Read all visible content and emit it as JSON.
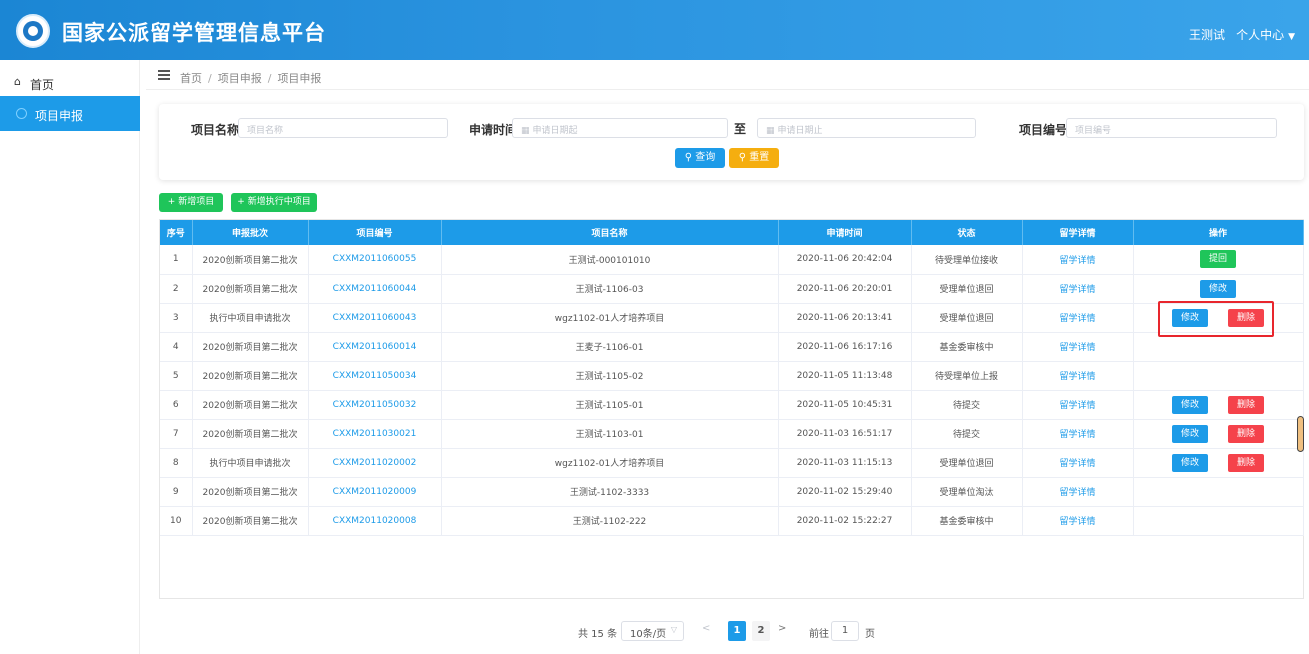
{
  "header": {
    "title": "国家公派留学管理信息平台",
    "user": "王测试",
    "user_menu": "个人中心"
  },
  "sidebar": {
    "items": [
      {
        "label": "首页"
      },
      {
        "label": "项目申报"
      }
    ]
  },
  "breadcrumb": [
    "首页",
    "项目申报",
    "项目申报"
  ],
  "search": {
    "project_name_label": "项目名称:",
    "project_name_placeholder": "项目名称",
    "apply_time_label": "申请时间:",
    "start_date_placeholder": "申请日期起",
    "to_label": "至",
    "end_date_placeholder": "申请日期止",
    "project_code_label": "项目编号:",
    "project_code_placeholder": "项目编号",
    "query_label": "查询",
    "reset_label": "重置"
  },
  "actions": {
    "add_project": "+ 新增项目",
    "add_exec_project": "+ 新增执行中项目"
  },
  "table": {
    "columns": [
      "序号",
      "申报批次",
      "项目编号",
      "项目名称",
      "申请时间",
      "状态",
      "留学详情",
      "操作"
    ],
    "rows": [
      {
        "no": "1",
        "batch": "2020创新项目第二批次",
        "code": "CXXM2011060055",
        "name": "王测试-000101010",
        "time": "2020-11-06 20:42:04",
        "status": "待受理单位接收",
        "detail": "留学详情",
        "ops": [
          "提回"
        ]
      },
      {
        "no": "2",
        "batch": "2020创新项目第二批次",
        "code": "CXXM2011060044",
        "name": "王测试-1106-03",
        "time": "2020-11-06 20:20:01",
        "status": "受理单位退回",
        "detail": "留学详情",
        "ops": [
          "修改"
        ]
      },
      {
        "no": "3",
        "batch": "执行中项目申请批次",
        "code": "CXXM2011060043",
        "name": "wgz1102-01人才培养项目",
        "time": "2020-11-06 20:13:41",
        "status": "受理单位退回",
        "detail": "留学详情",
        "ops": [
          "修改",
          "删除"
        ]
      },
      {
        "no": "4",
        "batch": "2020创新项目第二批次",
        "code": "CXXM2011060014",
        "name": "王麦子-1106-01",
        "time": "2020-11-06 16:17:16",
        "status": "基金委审核中",
        "detail": "留学详情",
        "ops": []
      },
      {
        "no": "5",
        "batch": "2020创新项目第二批次",
        "code": "CXXM2011050034",
        "name": "王测试-1105-02",
        "time": "2020-11-05 11:13:48",
        "status": "待受理单位上报",
        "detail": "留学详情",
        "ops": []
      },
      {
        "no": "6",
        "batch": "2020创新项目第二批次",
        "code": "CXXM2011050032",
        "name": "王测试-1105-01",
        "time": "2020-11-05 10:45:31",
        "status": "待提交",
        "detail": "留学详情",
        "ops": [
          "修改",
          "删除"
        ]
      },
      {
        "no": "7",
        "batch": "2020创新项目第二批次",
        "code": "CXXM2011030021",
        "name": "王测试-1103-01",
        "time": "2020-11-03 16:51:17",
        "status": "待提交",
        "detail": "留学详情",
        "ops": [
          "修改",
          "删除"
        ]
      },
      {
        "no": "8",
        "batch": "执行中项目申请批次",
        "code": "CXXM2011020002",
        "name": "wgz1102-01人才培养项目",
        "time": "2020-11-03 11:15:13",
        "status": "受理单位退回",
        "detail": "留学详情",
        "ops": [
          "修改",
          "删除"
        ]
      },
      {
        "no": "9",
        "batch": "2020创新项目第二批次",
        "code": "CXXM2011020009",
        "name": "王测试-1102-3333",
        "time": "2020-11-02 15:29:40",
        "status": "受理单位淘汰",
        "detail": "留学详情",
        "ops": []
      },
      {
        "no": "10",
        "batch": "2020创新项目第二批次",
        "code": "CXXM2011020008",
        "name": "王测试-1102-222",
        "time": "2020-11-02 15:22:27",
        "status": "基金委审核中",
        "detail": "留学详情",
        "ops": []
      }
    ]
  },
  "pagination": {
    "total": "共 15 条",
    "page_size": "10条/页",
    "pages": [
      "1",
      "2"
    ],
    "current": "1",
    "goto_label": "前往",
    "goto_value": "1",
    "goto_unit": "页"
  },
  "colors": {
    "primary": "#1d9be8",
    "success": "#1fc55a",
    "warning": "#f5ae0f",
    "danger": "#f5424b",
    "highlight": "#e8262d"
  },
  "icons": {
    "home": "home-icon",
    "menu": "menu-toggle-icon",
    "search": "search-icon",
    "calendar": "calendar-icon",
    "caret": "caret-down-icon"
  }
}
